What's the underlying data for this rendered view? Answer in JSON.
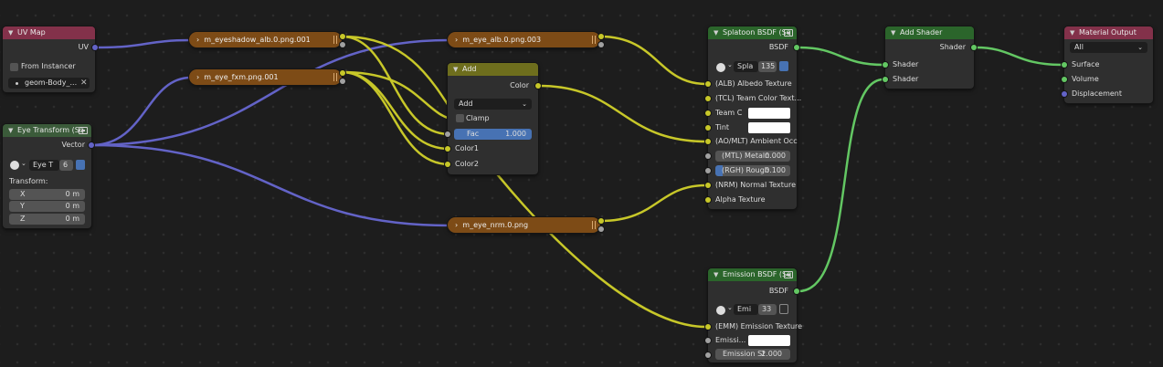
{
  "colors": {
    "background": "#1d1d1d",
    "node_body": "#2f2f2f",
    "header_input": "#83314a",
    "header_vector": "#3b5b3a",
    "header_converter": "#6e6e1d",
    "header_shader": "#2b652b",
    "header_output": "#83314a",
    "reroute_frame": "#7d4b16",
    "wire_vector": "#6363c7",
    "wire_color": "#c7c729",
    "wire_shader": "#63c763",
    "accent_blue": "#4772b3"
  },
  "reroutes": [
    {
      "label": "m_eyeshadow_alb.0.png.001"
    },
    {
      "label": "m_eye_fxm.png.001"
    },
    {
      "label": "m_eye_alb.0.png.003"
    },
    {
      "label": "m_eye_nrm.0.png"
    }
  ],
  "uv_map": {
    "title": "UV Map",
    "output": "UV",
    "from_instancer": "From Instancer",
    "uv_value": "geom-Body_..."
  },
  "eye_transform": {
    "title": "Eye Transform (Sq",
    "output": "Vector",
    "group_name": "Eye T",
    "users": "6",
    "transform_label": "Transform:",
    "x_label": "X",
    "x_value": "0 m",
    "y_label": "Y",
    "y_value": "0 m",
    "z_label": "Z",
    "z_value": "0 m"
  },
  "add": {
    "title": "Add",
    "output": "Color",
    "blend_mode": "Add",
    "clamp": "Clamp",
    "fac_label": "Fac",
    "fac_value": "1.000",
    "color1": "Color1",
    "color2": "Color2"
  },
  "splatoon_bsdf": {
    "title": "Splatoon BSDF (Sq",
    "output": "BSDF",
    "group_name": "Spla",
    "users": "135",
    "inputs": {
      "albedo": "(ALB) Albedo Texture",
      "team_color_tex": "(TCL) Team Color Text...",
      "team_c": "Team C",
      "tint": "Tint",
      "ao": "(AO/MLT) Ambient Occ",
      "metal_label": "(MTL) Metaln",
      "metal_value": "0.000",
      "rough_label": "(RGH) Rough",
      "rough_value": "0.100",
      "normal": "(NRM) Normal Texture",
      "alpha": "Alpha Texture"
    }
  },
  "emission_bsdf": {
    "title": "Emission BSDF (Sq",
    "output": "BSDF",
    "group_name": "Emi",
    "users": "33",
    "inputs": {
      "emission_tex": "(EMM) Emission Texture",
      "emission_color": "Emissi...",
      "strength_label": "Emission St",
      "strength_value": "2.000"
    }
  },
  "add_shader": {
    "title": "Add Shader",
    "output": "Shader",
    "input1": "Shader",
    "input2": "Shader"
  },
  "material_output": {
    "title": "Material Output",
    "target": "All",
    "surface": "Surface",
    "volume": "Volume",
    "displacement": "Displacement"
  }
}
